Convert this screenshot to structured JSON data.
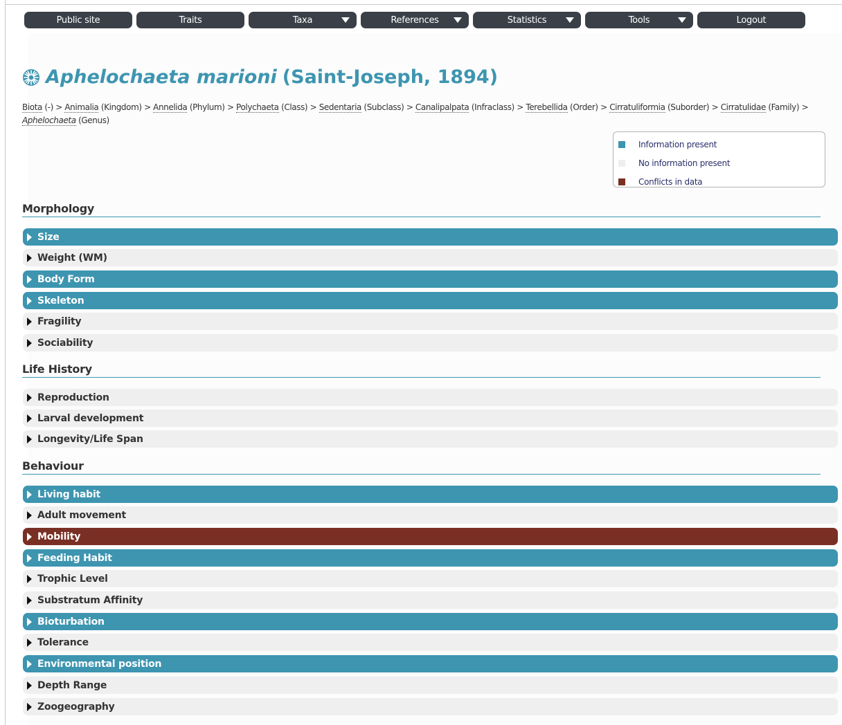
{
  "nav": {
    "items": [
      {
        "label": "Public site",
        "dropdown": false
      },
      {
        "label": "Traits",
        "dropdown": false
      },
      {
        "label": "Taxa",
        "dropdown": true
      },
      {
        "label": "References",
        "dropdown": true
      },
      {
        "label": "Statistics",
        "dropdown": true
      },
      {
        "label": "Tools",
        "dropdown": true
      },
      {
        "label": "Logout",
        "dropdown": false
      }
    ]
  },
  "taxon": {
    "icon": "polychaete-taxon-icon",
    "name": "Aphelochaeta marioni",
    "authority": "(Saint-Joseph, 1894)"
  },
  "breadcrumb": [
    {
      "name": "Biota",
      "rank": "(-)",
      "italic": false
    },
    {
      "name": "Animalia",
      "rank": "(Kingdom)",
      "italic": false
    },
    {
      "name": "Annelida",
      "rank": "(Phylum)",
      "italic": false
    },
    {
      "name": "Polychaeta",
      "rank": "(Class)",
      "italic": false
    },
    {
      "name": "Sedentaria",
      "rank": "(Subclass)",
      "italic": false
    },
    {
      "name": "Canalipalpata",
      "rank": "(Infraclass)",
      "italic": false
    },
    {
      "name": "Terebellida",
      "rank": "(Order)",
      "italic": false
    },
    {
      "name": "Cirratuliformia",
      "rank": "(Suborder)",
      "italic": false
    },
    {
      "name": "Cirratulidae",
      "rank": "(Family)",
      "italic": false
    },
    {
      "name": "Aphelochaeta",
      "rank": "(Genus)",
      "italic": true
    }
  ],
  "legend": {
    "present_label": "Information present",
    "absent_label": "No information present",
    "conflict_label": "Conflicts in data"
  },
  "colors": {
    "present": "#3d95b0",
    "absent": "#efefef",
    "conflict": "#7a2f24",
    "nav": "#3a3f48"
  },
  "sections": [
    {
      "title": "Morphology",
      "traits": [
        {
          "label": "Size",
          "status": "present"
        },
        {
          "label": "Weight (WM)",
          "status": "absent"
        },
        {
          "label": "Body Form",
          "status": "present"
        },
        {
          "label": "Skeleton",
          "status": "present"
        },
        {
          "label": "Fragility",
          "status": "absent"
        },
        {
          "label": "Sociability",
          "status": "absent"
        }
      ]
    },
    {
      "title": "Life History",
      "traits": [
        {
          "label": "Reproduction",
          "status": "absent"
        },
        {
          "label": "Larval development",
          "status": "absent"
        },
        {
          "label": "Longevity/Life Span",
          "status": "absent"
        }
      ]
    },
    {
      "title": "Behaviour",
      "traits": [
        {
          "label": "Living habit",
          "status": "present"
        },
        {
          "label": "Adult movement",
          "status": "absent"
        },
        {
          "label": "Mobility",
          "status": "conflict"
        },
        {
          "label": "Feeding Habit",
          "status": "present"
        },
        {
          "label": "Trophic Level",
          "status": "absent"
        },
        {
          "label": "Substratum Affinity",
          "status": "absent"
        },
        {
          "label": "Bioturbation",
          "status": "present"
        },
        {
          "label": "Tolerance",
          "status": "absent"
        },
        {
          "label": "Environmental position",
          "status": "present"
        },
        {
          "label": "Depth Range",
          "status": "absent"
        },
        {
          "label": "Zoogeography",
          "status": "absent"
        }
      ]
    }
  ]
}
